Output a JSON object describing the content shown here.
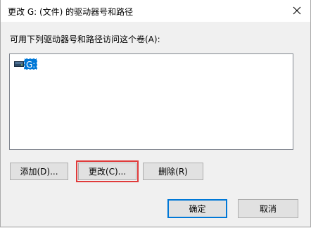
{
  "window": {
    "title": "更改 G: (文件) 的驱动器号和路径",
    "close_glyph": "✕"
  },
  "instruction": "可用下列驱动器号和路径访问这个卷(A):",
  "listbox": {
    "items": [
      {
        "label": "G:",
        "icon": "drive-icon",
        "selected": true
      }
    ]
  },
  "buttons": {
    "add": "添加(D)...",
    "change": "更改(C)...",
    "remove": "删除(R)",
    "ok": "确定",
    "cancel": "取消"
  },
  "colors": {
    "selection": "#0078d7",
    "highlight": "#e03b3b",
    "default_button_border": "#0078d7"
  }
}
